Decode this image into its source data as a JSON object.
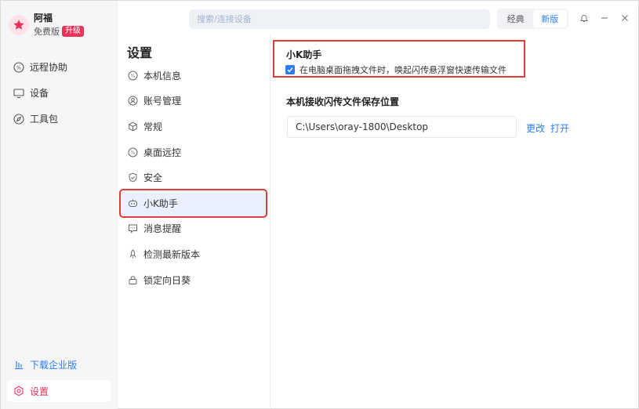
{
  "profile": {
    "name": "阿福",
    "plan": "免费版",
    "upgrade_label": "升级"
  },
  "nav": [
    {
      "label": "远程协助",
      "icon": "remote-assist-icon"
    },
    {
      "label": "设备",
      "icon": "monitor-icon"
    },
    {
      "label": "工具包",
      "icon": "compass-icon"
    }
  ],
  "bottom_nav": {
    "download_label": "下载企业版",
    "settings_label": "设置"
  },
  "search": {
    "placeholder": "搜索/连接设备",
    "value": ""
  },
  "mode_switch": {
    "classic_label": "经典",
    "new_label": "新版",
    "active": "新版"
  },
  "settings_menu": {
    "title": "设置",
    "items": [
      {
        "label": "本机信息",
        "icon": "device-info-icon"
      },
      {
        "label": "账号管理",
        "icon": "account-icon"
      },
      {
        "label": "常规",
        "icon": "cube-icon"
      },
      {
        "label": "桌面远控",
        "icon": "remote-desktop-icon"
      },
      {
        "label": "安全",
        "icon": "shield-icon"
      },
      {
        "label": "小K助手",
        "icon": "robot-icon"
      },
      {
        "label": "消息提醒",
        "icon": "message-icon"
      },
      {
        "label": "检测最新版本",
        "icon": "rocket-icon"
      },
      {
        "label": "锁定向日葵",
        "icon": "lock-icon"
      }
    ],
    "active_index": 5
  },
  "k_assistant": {
    "title": "小K助手",
    "checkbox_label": "在电脑桌面拖拽文件时，唤起闪传悬浮窗快速传输文件",
    "checked": true
  },
  "save_location": {
    "title": "本机接收闪传文件保存位置",
    "path": "C:\\Users\\oray-1800\\Desktop",
    "change_label": "更改",
    "open_label": "打开"
  },
  "colors": {
    "accent": "#2f7df6",
    "brand": "#e8335a",
    "highlight_box": "#e03c3c"
  }
}
